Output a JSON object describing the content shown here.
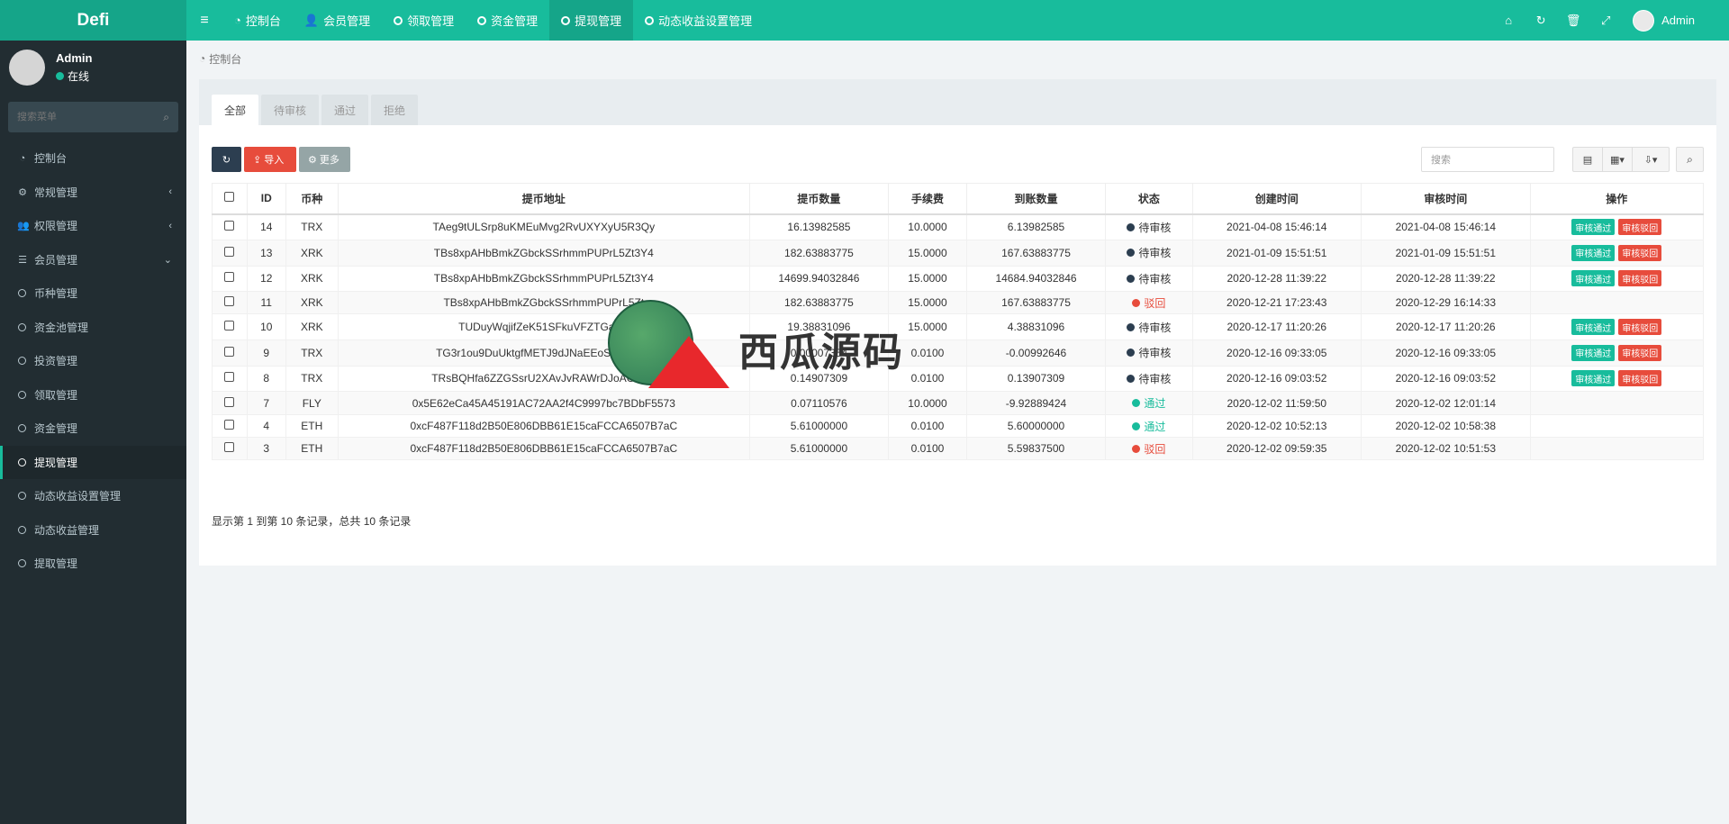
{
  "brand": "Defi",
  "topnav": [
    {
      "label": "控制台",
      "icon": "dashboard-icon",
      "active": false
    },
    {
      "label": "会员管理",
      "icon": "user-icon",
      "active": false
    },
    {
      "label": "领取管理",
      "icon": "circle-icon",
      "active": false
    },
    {
      "label": "资金管理",
      "icon": "circle-icon",
      "active": false
    },
    {
      "label": "提现管理",
      "icon": "circle-icon",
      "active": true
    },
    {
      "label": "动态收益设置管理",
      "icon": "circle-icon",
      "active": false
    }
  ],
  "topbar_user": "Admin",
  "sidebar": {
    "user_name": "Admin",
    "status": "在线",
    "status_color": "#18bc9c",
    "search_placeholder": "搜索菜单",
    "items": [
      {
        "label": "控制台",
        "icon": "dashboard-icon"
      },
      {
        "label": "常规管理",
        "icon": "cogs-icon",
        "arrow": "‹"
      },
      {
        "label": "权限管理",
        "icon": "group-icon",
        "arrow": "‹"
      },
      {
        "label": "会员管理",
        "icon": "list-icon",
        "arrow": "⌄"
      },
      {
        "label": "币种管理",
        "icon": "circle-icon"
      },
      {
        "label": "资金池管理",
        "icon": "circle-icon"
      },
      {
        "label": "投资管理",
        "icon": "circle-icon"
      },
      {
        "label": "领取管理",
        "icon": "circle-icon"
      },
      {
        "label": "资金管理",
        "icon": "circle-icon"
      },
      {
        "label": "提现管理",
        "icon": "circle-icon",
        "active": true
      },
      {
        "label": "动态收益设置管理",
        "icon": "circle-icon"
      },
      {
        "label": "动态收益管理",
        "icon": "circle-icon"
      },
      {
        "label": "提取管理",
        "icon": "circle-icon"
      }
    ]
  },
  "breadcrumb": "控制台",
  "tabs": [
    "全部",
    "待审核",
    "通过",
    "拒绝"
  ],
  "toolbar": {
    "import": "导入",
    "more": "更多",
    "search_placeholder": "搜索"
  },
  "table": {
    "headers": [
      "ID",
      "币种",
      "提币地址",
      "提币数量",
      "手续费",
      "到账数量",
      "状态",
      "创建时间",
      "审核时间",
      "操作"
    ],
    "rows": [
      {
        "id": "14",
        "coin": "TRX",
        "addr": "TAeg9tULSrp8uKMEuMvg2RvUXYXyU5R3Qy",
        "amount": "16.13982585",
        "fee": "10.0000",
        "received": "6.13982585",
        "status": "待审核",
        "scolor": "#2c3e50",
        "created": "2021-04-08 15:46:14",
        "audited": "2021-04-08 15:46:14",
        "ops": true
      },
      {
        "id": "13",
        "coin": "XRK",
        "addr": "TBs8xpAHbBmkZGbckSSrhmmPUPrL5Zt3Y4",
        "amount": "182.63883775",
        "fee": "15.0000",
        "received": "167.63883775",
        "status": "待审核",
        "scolor": "#2c3e50",
        "created": "2021-01-09 15:51:51",
        "audited": "2021-01-09 15:51:51",
        "ops": true
      },
      {
        "id": "12",
        "coin": "XRK",
        "addr": "TBs8xpAHbBmkZGbckSSrhmmPUPrL5Zt3Y4",
        "amount": "14699.94032846",
        "fee": "15.0000",
        "received": "14684.94032846",
        "status": "待审核",
        "scolor": "#2c3e50",
        "created": "2020-12-28 11:39:22",
        "audited": "2020-12-28 11:39:22",
        "ops": true
      },
      {
        "id": "11",
        "coin": "XRK",
        "addr": "TBs8xpAHbBmkZGbckSSrhmmPUPrL5Zt",
        "amount": "182.63883775",
        "fee": "15.0000",
        "received": "167.63883775",
        "status": "驳回",
        "scolor": "#e74c3c",
        "created": "2020-12-21 17:23:43",
        "audited": "2020-12-29 16:14:33",
        "ops": false
      },
      {
        "id": "10",
        "coin": "XRK",
        "addr": "TUDuyWqjifZeK51SFkuVFZTGarzz",
        "amount": "19.38831096",
        "fee": "15.0000",
        "received": "4.38831096",
        "status": "待审核",
        "scolor": "#2c3e50",
        "created": "2020-12-17 11:20:26",
        "audited": "2020-12-17 11:20:26",
        "ops": true
      },
      {
        "id": "9",
        "coin": "TRX",
        "addr": "TG3r1ou9DuUktgfMETJ9dJNaEEoSAZThBB",
        "amount": "0.00007354",
        "fee": "0.0100",
        "received": "-0.00992646",
        "status": "待审核",
        "scolor": "#2c3e50",
        "created": "2020-12-16 09:33:05",
        "audited": "2020-12-16 09:33:05",
        "ops": true
      },
      {
        "id": "8",
        "coin": "TRX",
        "addr": "TRsBQHfa6ZZGSsrU2XAvJvRAWrDJoAGGBy",
        "amount": "0.14907309",
        "fee": "0.0100",
        "received": "0.13907309",
        "status": "待审核",
        "scolor": "#2c3e50",
        "created": "2020-12-16 09:03:52",
        "audited": "2020-12-16 09:03:52",
        "ops": true
      },
      {
        "id": "7",
        "coin": "FLY",
        "addr": "0x5E62eCa45A45191AC72AA2f4C9997bc7BDbF5573",
        "amount": "0.07110576",
        "fee": "10.0000",
        "received": "-9.92889424",
        "status": "通过",
        "scolor": "#18bc9c",
        "created": "2020-12-02 11:59:50",
        "audited": "2020-12-02 12:01:14",
        "ops": false
      },
      {
        "id": "4",
        "coin": "ETH",
        "addr": "0xcF487F118d2B50E806DBB61E15caFCCA6507B7aC",
        "amount": "5.61000000",
        "fee": "0.0100",
        "received": "5.60000000",
        "status": "通过",
        "scolor": "#18bc9c",
        "created": "2020-12-02 10:52:13",
        "audited": "2020-12-02 10:58:38",
        "ops": false
      },
      {
        "id": "3",
        "coin": "ETH",
        "addr": "0xcF487F118d2B50E806DBB61E15caFCCA6507B7aC",
        "amount": "5.61000000",
        "fee": "0.0100",
        "received": "5.59837500",
        "status": "驳回",
        "scolor": "#e74c3c",
        "created": "2020-12-02 09:59:35",
        "audited": "2020-12-02 10:51:53",
        "ops": false
      }
    ],
    "approve_label": "审核通过",
    "reject_label": "审核驳回"
  },
  "pagination_info": "显示第 1 到第 10 条记录，总共 10 条记录",
  "watermark": "西瓜源码"
}
